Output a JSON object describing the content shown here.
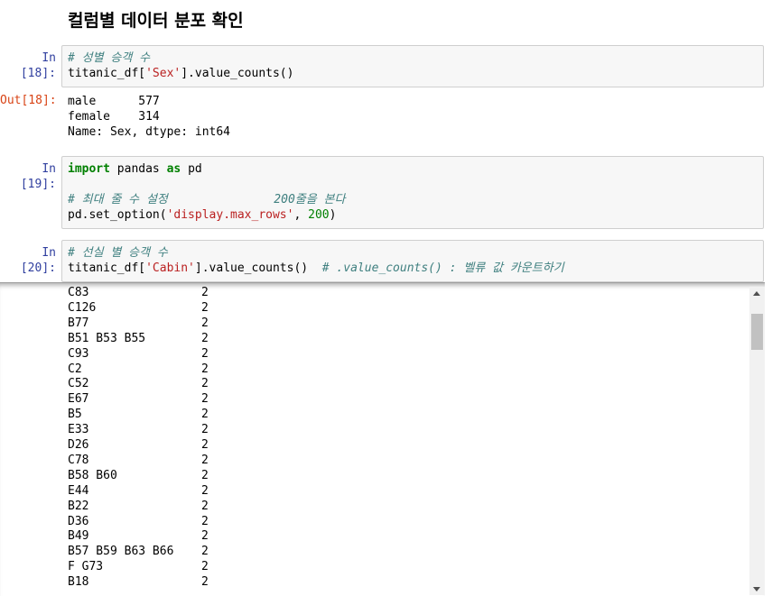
{
  "heading": "컬럼별 데이터 분포 확인",
  "cells": [
    {
      "prompt": "In [18]:",
      "lines": [
        [
          {
            "t": "# 성별 승객 수",
            "c": "cm"
          }
        ],
        [
          {
            "t": "titanic_df[",
            "c": ""
          },
          {
            "t": "'Sex'",
            "c": "str"
          },
          {
            "t": "].value_counts()",
            "c": ""
          }
        ]
      ]
    },
    {
      "prompt": "In [19]:",
      "lines": [
        [
          {
            "t": "import",
            "c": "kw"
          },
          {
            "t": " pandas ",
            "c": ""
          },
          {
            "t": "as",
            "c": "kw"
          },
          {
            "t": " pd",
            "c": ""
          }
        ],
        [
          {
            "t": "",
            "c": ""
          }
        ],
        [
          {
            "t": "# 최대 줄 수 설정               200줄을 본다",
            "c": "cm"
          }
        ],
        [
          {
            "t": "pd.set_option(",
            "c": ""
          },
          {
            "t": "'display.max_rows'",
            "c": "str"
          },
          {
            "t": ", ",
            "c": ""
          },
          {
            "t": "200",
            "c": "num"
          },
          {
            "t": ")",
            "c": ""
          }
        ]
      ]
    },
    {
      "prompt": "In [20]:",
      "lines": [
        [
          {
            "t": "# 선실 별 승객 수",
            "c": "cm"
          }
        ],
        [
          {
            "t": "titanic_df[",
            "c": ""
          },
          {
            "t": "'Cabin'",
            "c": "str"
          },
          {
            "t": "].value_counts()  ",
            "c": ""
          },
          {
            "t": "# .value_counts() : 벨류 값 카운트하기",
            "c": "cm"
          }
        ]
      ]
    }
  ],
  "output18": {
    "prompt": "Out[18]:",
    "lines": [
      "male      577",
      "female    314",
      "Name: Sex, dtype: int64"
    ]
  },
  "cabin_counts": [
    {
      "cabin": "C83",
      "count": "2"
    },
    {
      "cabin": "C126",
      "count": "2"
    },
    {
      "cabin": "B77",
      "count": "2"
    },
    {
      "cabin": "B51 B53 B55",
      "count": "2"
    },
    {
      "cabin": "C93",
      "count": "2"
    },
    {
      "cabin": "C2",
      "count": "2"
    },
    {
      "cabin": "C52",
      "count": "2"
    },
    {
      "cabin": "E67",
      "count": "2"
    },
    {
      "cabin": "B5",
      "count": "2"
    },
    {
      "cabin": "E33",
      "count": "2"
    },
    {
      "cabin": "D26",
      "count": "2"
    },
    {
      "cabin": "C78",
      "count": "2"
    },
    {
      "cabin": "B58 B60",
      "count": "2"
    },
    {
      "cabin": "E44",
      "count": "2"
    },
    {
      "cabin": "B22",
      "count": "2"
    },
    {
      "cabin": "D36",
      "count": "2"
    },
    {
      "cabin": "B49",
      "count": "2"
    },
    {
      "cabin": "B57 B59 B63 B66",
      "count": "2"
    },
    {
      "cabin": "F G73",
      "count": "2"
    },
    {
      "cabin": "B18",
      "count": "2"
    }
  ],
  "icons": {
    "scroll_up": "arrow-up-icon",
    "scroll_down": "arrow-down-icon"
  }
}
